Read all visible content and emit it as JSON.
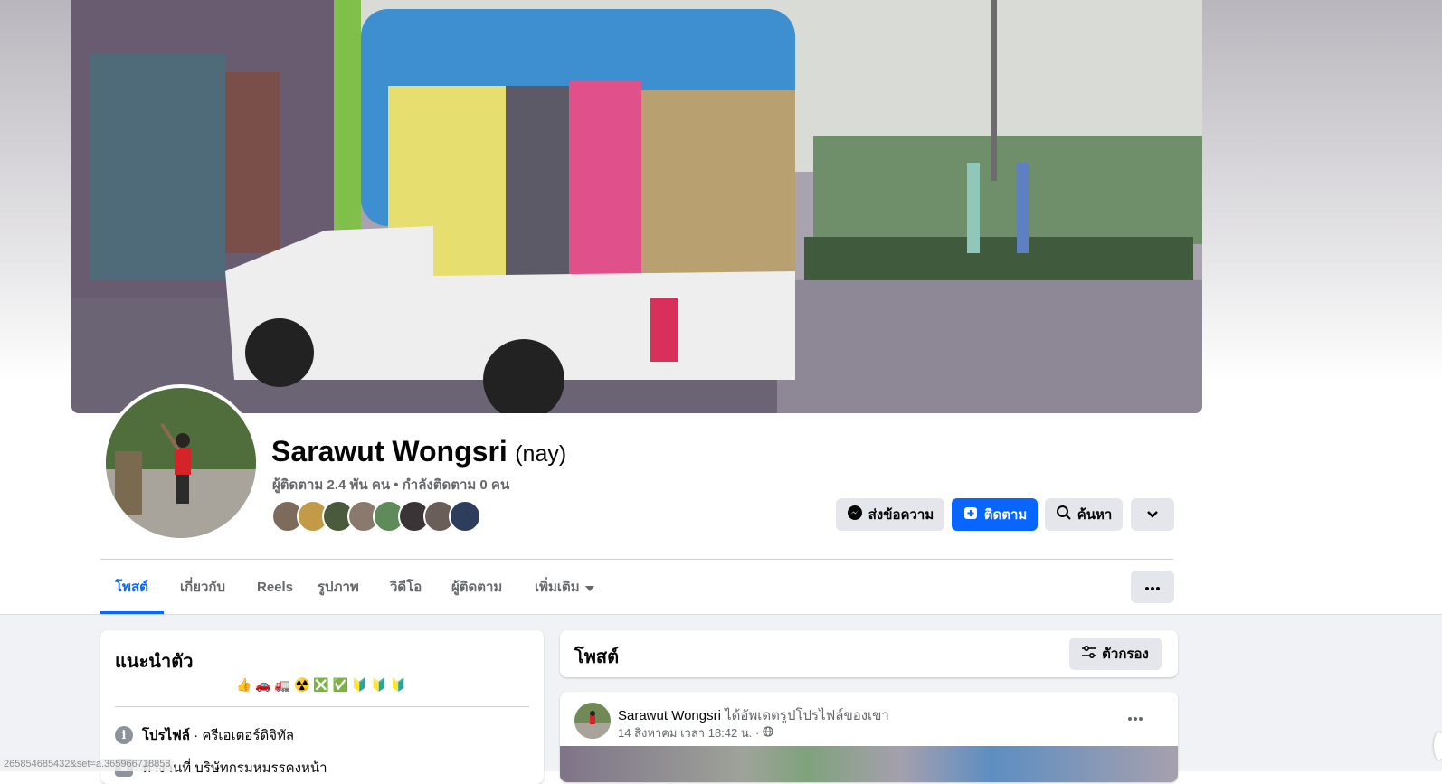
{
  "profile": {
    "name": "Sarawut Wongsri",
    "alternate_name": "(nay)",
    "stats": "ผู้ติดตาม 2.4 พัน คน • กำลังติดตาม 0 คน"
  },
  "actions": {
    "message_label": "ส่งข้อความ",
    "follow_label": "ติดตาม",
    "search_label": "ค้นหา"
  },
  "tabs": [
    {
      "label": "โพสต์",
      "active": true
    },
    {
      "label": "เกี่ยวกับ",
      "active": false
    },
    {
      "label": "Reels",
      "active": false
    },
    {
      "label": "รูปภาพ",
      "active": false
    },
    {
      "label": "วิดีโอ",
      "active": false
    },
    {
      "label": "ผู้ติดตาม",
      "active": false
    },
    {
      "label": "เพิ่มเติม",
      "active": false
    }
  ],
  "intro": {
    "title": "แนะนำตัว",
    "bio": "👍 🚗 🚛 ☢️ ❎ ✅ 🔰 🔰 🔰",
    "profile_label": "โปรไฟล์",
    "profile_value": " · ครีเอเตอร์ดิจิทัล",
    "second_row": "ทำงานที่ บริษัทกรมหมรรคงหน้า"
  },
  "posts": {
    "title": "โพสต์",
    "filter_label": "ตัวกรอง",
    "items": [
      {
        "author": "Sarawut Wongsri",
        "action": " ได้อัพเดตรูปโปรไฟล์ของเขา",
        "time": "14 สิงหาคม เวลา 18:42 น. ·"
      }
    ]
  },
  "status_bar": {
    "url": "265854685432&set=a.365966718858"
  },
  "colors": {
    "accent": "#0866ff",
    "button_grey": "#e4e6eb",
    "secondary_text": "#65676b"
  }
}
